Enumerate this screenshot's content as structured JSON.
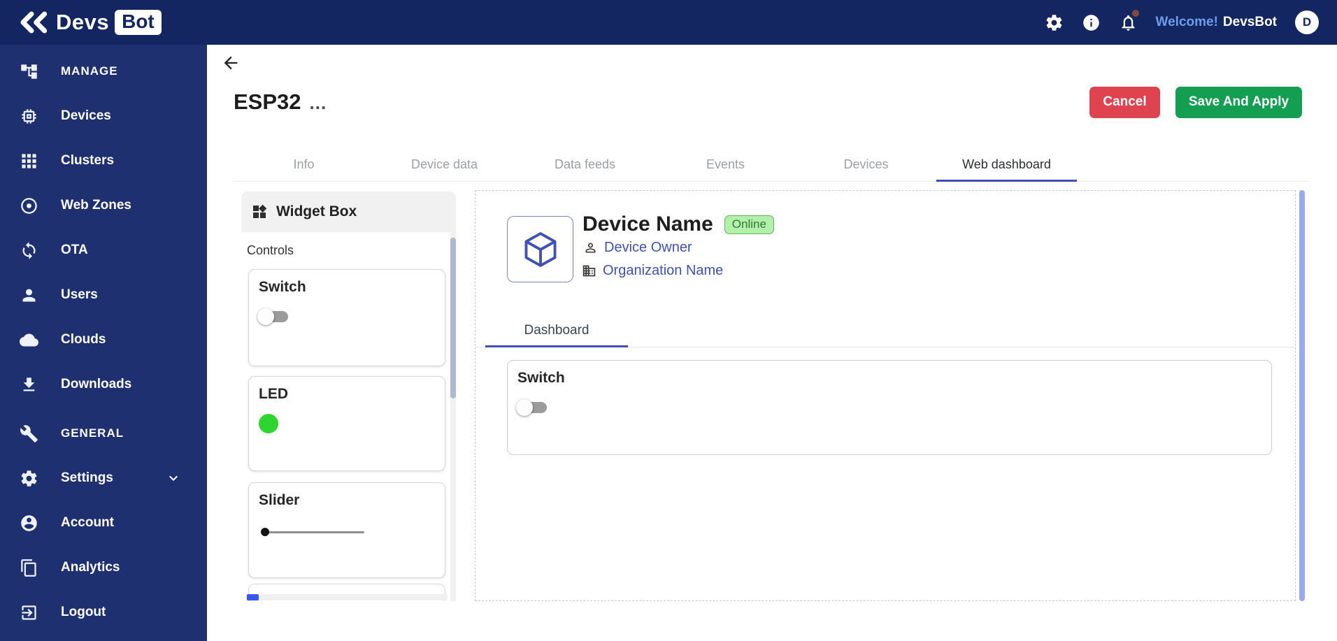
{
  "topbar": {
    "brand_part1": "Devs",
    "brand_part2": "Bot",
    "welcome": "Welcome!",
    "username": "DevsBot",
    "avatar_initial": "D"
  },
  "sidebar": {
    "items": [
      {
        "label": "MANAGE",
        "type": "header"
      },
      {
        "label": "Devices",
        "type": "item"
      },
      {
        "label": "Clusters",
        "type": "item"
      },
      {
        "label": "Web Zones",
        "type": "item"
      },
      {
        "label": "OTA",
        "type": "item"
      },
      {
        "label": "Users",
        "type": "item"
      },
      {
        "label": "Clouds",
        "type": "item"
      },
      {
        "label": "Downloads",
        "type": "item"
      },
      {
        "label": "GENERAL",
        "type": "header"
      },
      {
        "label": "Settings",
        "type": "item",
        "expandable": true
      },
      {
        "label": "Account",
        "type": "item"
      },
      {
        "label": "Analytics",
        "type": "item"
      },
      {
        "label": "Logout",
        "type": "item"
      }
    ]
  },
  "header": {
    "title": "ESP32",
    "more_label": "...",
    "cancel_label": "Cancel",
    "save_label": "Save And Apply"
  },
  "tabs": [
    {
      "label": "Info",
      "active": false
    },
    {
      "label": "Device data",
      "active": false
    },
    {
      "label": "Data feeds",
      "active": false
    },
    {
      "label": "Events",
      "active": false
    },
    {
      "label": "Devices",
      "active": false
    },
    {
      "label": "Web dashboard",
      "active": true
    }
  ],
  "widget_box": {
    "title": "Widget Box",
    "section": "Controls",
    "widgets": [
      {
        "name": "Switch",
        "type": "switch",
        "state": "off"
      },
      {
        "name": "LED",
        "type": "led",
        "color": "#2ed52e"
      },
      {
        "name": "Slider",
        "type": "slider",
        "value": 0
      }
    ]
  },
  "preview": {
    "device_name": "Device Name",
    "status": "Online",
    "owner": "Device Owner",
    "organization": "Organization Name",
    "tab": "Dashboard",
    "widget_name": "Switch",
    "widget_state": "off"
  },
  "colors": {
    "topbar_navy": "#142661",
    "sidebar_navy": "#1e3070",
    "accent_indigo": "#3f51b5",
    "cancel_red": "#e04350",
    "save_green": "#149e52",
    "online_bg": "#b4efab",
    "online_border": "#58b85c",
    "online_text": "#2c7d33",
    "led_green": "#2ed52e"
  }
}
